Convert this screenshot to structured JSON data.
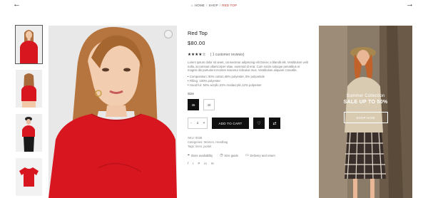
{
  "nav": {
    "prev_arrow": "←",
    "next_arrow": "→",
    "breadcrumb": {
      "home_icon": "⌂",
      "home": "HOME",
      "sep1": "/",
      "shop": "SHOP",
      "sep2": "/",
      "current": "RED TOP"
    }
  },
  "gallery": {
    "zoom_icon": "⤢",
    "thumbnails": [
      "thumb-front",
      "thumb-back",
      "thumb-dark",
      "thumb-flat"
    ]
  },
  "product": {
    "title": "Red Top",
    "price": "$80.00",
    "stars": "★★★★☆",
    "reviews": "( 1 customer reviews)",
    "description": "Lorem ipsum dolor sit amet, consectetur adipiscing elit Donec a blandit elit. Vestibulum velit nulla, accumsan ullamcorper vitae, euismod id erat. Cum sociis natoque penatibus et magnis dis parturient montes nascetur ridiculus mus. Vestibulum aliquam convallis.",
    "features": [
      "Composition: 50% cotton,45% polyester, 5% polyamide",
      "Filling: 100% polyester",
      "Hood fur: 54% acrylic,21% modacrylic,12% polyester"
    ],
    "size_label": "Size",
    "sizes": [
      "36",
      "40"
    ],
    "quantity": {
      "minus": "-",
      "value": "1",
      "plus": "+"
    },
    "add_to_cart": "ADD TO CART",
    "wishlist_icon": "♡",
    "compare_icon": "⇄",
    "meta": {
      "sku": "SKU: 0038",
      "categories": "Categories: Women, Handbag",
      "tags": "Tags: linen, jacket"
    },
    "links": [
      {
        "icon": "⌖",
        "label": "Store availability"
      },
      {
        "icon": "◷",
        "label": "Size guide"
      },
      {
        "icon": "▭",
        "label": "Delivery and return"
      }
    ],
    "social": [
      "f",
      "t",
      "P",
      "in",
      "✉"
    ]
  },
  "promo": {
    "subtitle": "Summer Collection",
    "title": "SALE UP TO 50%",
    "button": "SHOP NOW"
  },
  "colors": {
    "accent": "#111111",
    "product_red": "#d8161f",
    "breadcrumb_current": "#c0392b"
  }
}
